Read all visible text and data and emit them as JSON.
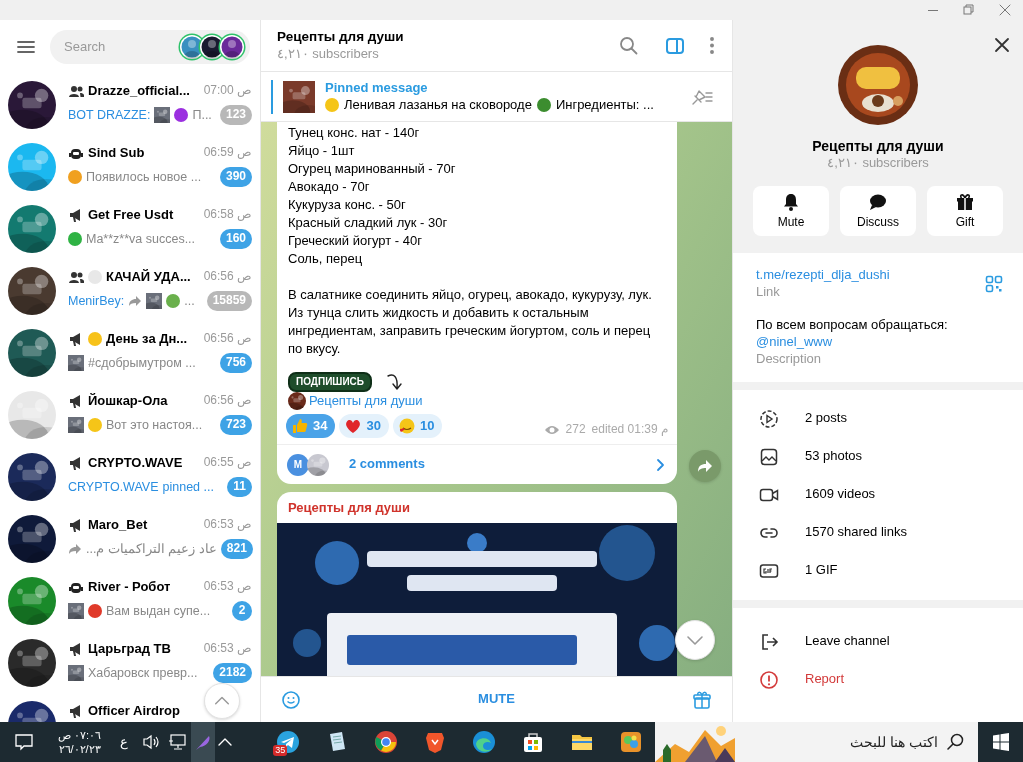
{
  "window": {
    "controls": [
      {
        "kind": "minimize"
      },
      {
        "kind": "restore"
      },
      {
        "kind": "close"
      }
    ]
  },
  "sidebar": {
    "search_placeholder": "Search",
    "chats": [
      {
        "kind": "group",
        "name": "Drazze_official...",
        "time": "07:00 ص",
        "preview": [
          {
            "kind": "sender",
            "text": "BOT DRAZZE:"
          },
          {
            "kind": "thumb"
          },
          {
            "kind": "emoji",
            "color": "#9b30e0"
          },
          {
            "kind": "text",
            "text": "П..."
          }
        ],
        "unread": "123",
        "muted": true
      },
      {
        "kind": "bot",
        "name": "Sind Sub",
        "time": "06:59 ص",
        "preview": [
          {
            "kind": "emoji",
            "color": "#f0a020"
          },
          {
            "kind": "text",
            "text": "Появилось новое ..."
          }
        ],
        "unread": "390",
        "muted": false
      },
      {
        "kind": "channel",
        "name": "Get Free Usdt",
        "time": "06:58 ص",
        "preview": [
          {
            "kind": "emoji",
            "color": "#2fb344"
          },
          {
            "kind": "text",
            "text": "Ma**z**va succes..."
          }
        ],
        "unread": "160",
        "muted": false
      },
      {
        "kind": "group",
        "name_emoji": {
          "color": "#e8e8e8"
        },
        "name": "КАЧАЙ УДА...",
        "time": "06:56 ص",
        "preview": [
          {
            "kind": "sender",
            "text": "MenirBey:"
          },
          {
            "kind": "forward"
          },
          {
            "kind": "thumb"
          },
          {
            "kind": "emoji",
            "color": "#6ab04c"
          },
          {
            "kind": "text",
            "text": "..."
          }
        ],
        "unread": "15859",
        "muted": true
      },
      {
        "kind": "channel",
        "name_emoji": {
          "color": "#f7c21a"
        },
        "name": "День за Дн...",
        "time": "06:56 ص",
        "preview": [
          {
            "kind": "thumb"
          },
          {
            "kind": "text",
            "text": "#сдобрымутром ..."
          }
        ],
        "unread": "756",
        "muted": false
      },
      {
        "kind": "channel",
        "name": "Йошкар-Ола",
        "time": "06:56 ص",
        "preview": [
          {
            "kind": "thumb"
          },
          {
            "kind": "emoji",
            "color": "#f5c518"
          },
          {
            "kind": "text",
            "text": "Вот это настоя..."
          }
        ],
        "unread": "723",
        "muted": false
      },
      {
        "kind": "channel",
        "name": "CRYPTO.WAVE",
        "time": "06:55 ص",
        "preview": [
          {
            "kind": "sender",
            "text": "CRYPTO.WAVE"
          },
          {
            "kind": "action",
            "text": "pinned ..."
          }
        ],
        "unread": "11",
        "muted": false
      },
      {
        "kind": "channel",
        "name": "Maro_Bet",
        "time": "06:53 ص",
        "preview": [
          {
            "kind": "forward"
          },
          {
            "kind": "text",
            "text": "عاد زعيم التراكميات م..."
          }
        ],
        "unread": "821",
        "muted": false
      },
      {
        "kind": "bot",
        "name": "River - Робот",
        "time": "06:53 ص",
        "preview": [
          {
            "kind": "thumb"
          },
          {
            "kind": "emoji",
            "color": "#e03a2a"
          },
          {
            "kind": "text",
            "text": "Вам выдан супе..."
          }
        ],
        "unread": "2",
        "muted": false
      },
      {
        "kind": "channel",
        "name": "Царьград ТВ",
        "time": "06:53 ص",
        "preview": [
          {
            "kind": "thumb"
          },
          {
            "kind": "text",
            "text": "Хабаровск превр..."
          }
        ],
        "unread": "2182",
        "muted": false
      },
      {
        "kind": "channel",
        "name": "Officer Airdrop"
      }
    ]
  },
  "chat": {
    "title": "Рецепты для души",
    "subtitle": "٤,٢١٠ subscribers",
    "pinned": {
      "title": "Pinned message",
      "segments": [
        {
          "kind": "emoji",
          "color": "#f5c518"
        },
        {
          "kind": "text",
          "text": "Ленивая лазанья на сковороде"
        },
        {
          "kind": "emoji",
          "color": "#3c8d2f"
        },
        {
          "kind": "text",
          "text": "Ингредиенты: ..."
        }
      ]
    },
    "message": {
      "lines": [
        "Тунец конс. нат - 140г",
        "Яйцо - 1шт",
        "Огурец маринованный - 70г",
        "Авокадо - 70г",
        "Кукуруза конс. - 50г",
        "Красный сладкий лук - 30г",
        "Греческий йогурт - 40г",
        "Соль, перец"
      ],
      "paragraph": "В салатнике соединить яйцо, огурец, авокадо, кукурузу, лук. Из тунца слить жидкость и добавить к остальным ингредиентам, заправить греческим йогуртом, соль и перец по вкусу.",
      "sticker": "ПОДПИШИСЬ",
      "link": "Рецепты для души",
      "reactions": [
        {
          "kind": "like",
          "count": "34",
          "selected": true
        },
        {
          "kind": "heart",
          "count": "30",
          "selected": false
        },
        {
          "kind": "love",
          "count": "10",
          "selected": false
        }
      ],
      "views": "272",
      "edited": "edited 01:39 م",
      "comments": {
        "initial": "M",
        "label": "2 comments"
      }
    },
    "next_message": {
      "author": "Рецепты для души",
      "kind": "picture"
    },
    "composer": {
      "label": "MUTE"
    }
  },
  "profile": {
    "name": "Рецепты для души",
    "subscribers": "٤,٢١٠ subscribers",
    "actions": [
      {
        "kind": "mute",
        "label": "Mute"
      },
      {
        "kind": "discuss",
        "label": "Discuss"
      },
      {
        "kind": "gift",
        "label": "Gift"
      }
    ],
    "link": "t.me/rezepti_dlja_dushi",
    "link_caption": "Link",
    "description": "По всем вопросам обращаться:",
    "description_link": "@ninel_www",
    "description_caption": "Description",
    "media": [
      {
        "kind": "posts",
        "label": "2 posts"
      },
      {
        "kind": "photos",
        "label": "53 photos"
      },
      {
        "kind": "videos",
        "label": "1609 videos"
      },
      {
        "kind": "links",
        "label": "1570 shared links"
      },
      {
        "kind": "gif",
        "label": "1 GIF"
      }
    ],
    "bottom": [
      {
        "kind": "leave",
        "label": "Leave channel",
        "danger": false
      },
      {
        "kind": "report",
        "label": "Report",
        "danger": true
      }
    ]
  },
  "taskbar": {
    "time": "٠٧:٠٦ ص",
    "date": "٢٦/٠٢/٢٣",
    "language": "ع",
    "search_placeholder": "اكتب هنا للبحث",
    "apps": [
      {
        "kind": "telegram",
        "badge": "35"
      },
      {
        "kind": "notes"
      },
      {
        "kind": "chrome"
      },
      {
        "kind": "brave"
      },
      {
        "kind": "edge"
      },
      {
        "kind": "store"
      },
      {
        "kind": "explorer"
      },
      {
        "kind": "game"
      }
    ]
  }
}
